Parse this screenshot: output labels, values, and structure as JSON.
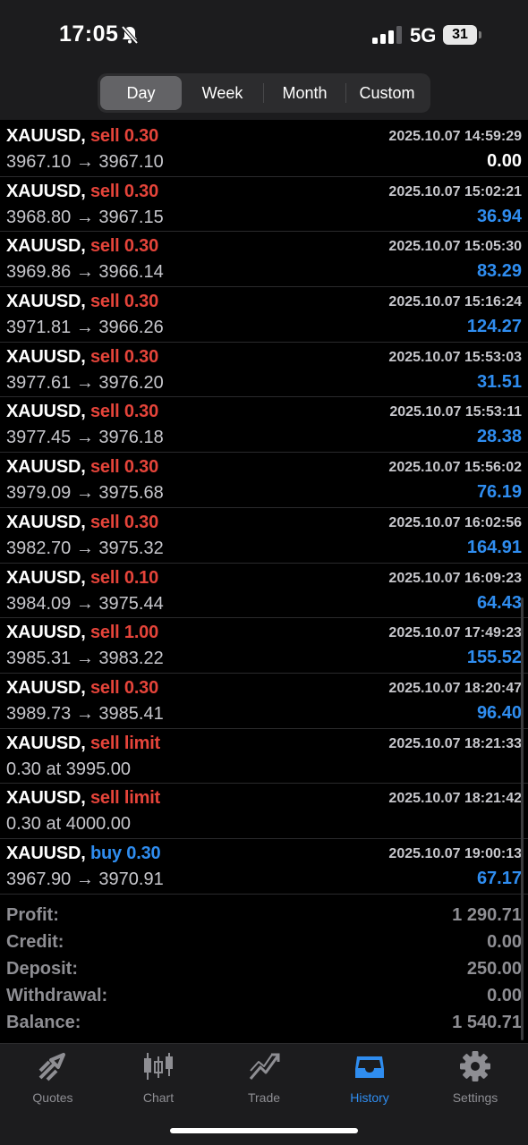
{
  "status": {
    "time": "17:05",
    "network": "5G",
    "battery": "31"
  },
  "segments": [
    {
      "label": "Day",
      "active": true
    },
    {
      "label": "Week",
      "active": false
    },
    {
      "label": "Month",
      "active": false
    },
    {
      "label": "Custom",
      "active": false
    }
  ],
  "trades": [
    {
      "symbol": "XAUUSD,",
      "side": "sell 0.30",
      "dir": "sell",
      "time": "2025.10.07 14:59:29",
      "detail": "3967.10 → 3967.10",
      "profit": "0.00",
      "zero": true
    },
    {
      "symbol": "XAUUSD,",
      "side": "sell 0.30",
      "dir": "sell",
      "time": "2025.10.07 15:02:21",
      "detail": "3968.80 → 3967.15",
      "profit": "36.94"
    },
    {
      "symbol": "XAUUSD,",
      "side": "sell 0.30",
      "dir": "sell",
      "time": "2025.10.07 15:05:30",
      "detail": "3969.86 → 3966.14",
      "profit": "83.29"
    },
    {
      "symbol": "XAUUSD,",
      "side": "sell 0.30",
      "dir": "sell",
      "time": "2025.10.07 15:16:24",
      "detail": "3971.81 → 3966.26",
      "profit": "124.27"
    },
    {
      "symbol": "XAUUSD,",
      "side": "sell 0.30",
      "dir": "sell",
      "time": "2025.10.07 15:53:03",
      "detail": "3977.61 → 3976.20",
      "profit": "31.51"
    },
    {
      "symbol": "XAUUSD,",
      "side": "sell 0.30",
      "dir": "sell",
      "time": "2025.10.07 15:53:11",
      "detail": "3977.45 → 3976.18",
      "profit": "28.38"
    },
    {
      "symbol": "XAUUSD,",
      "side": "sell 0.30",
      "dir": "sell",
      "time": "2025.10.07 15:56:02",
      "detail": "3979.09 → 3975.68",
      "profit": "76.19"
    },
    {
      "symbol": "XAUUSD,",
      "side": "sell 0.30",
      "dir": "sell",
      "time": "2025.10.07 16:02:56",
      "detail": "3982.70 → 3975.32",
      "profit": "164.91"
    },
    {
      "symbol": "XAUUSD,",
      "side": "sell 0.10",
      "dir": "sell",
      "time": "2025.10.07 16:09:23",
      "detail": "3984.09 → 3975.44",
      "profit": "64.43"
    },
    {
      "symbol": "XAUUSD,",
      "side": "sell 1.00",
      "dir": "sell",
      "time": "2025.10.07 17:49:23",
      "detail": "3985.31 → 3983.22",
      "profit": "155.52"
    },
    {
      "symbol": "XAUUSD,",
      "side": "sell 0.30",
      "dir": "sell",
      "time": "2025.10.07 18:20:47",
      "detail": "3989.73 → 3985.41",
      "profit": "96.40"
    },
    {
      "symbol": "XAUUSD,",
      "side": "sell limit",
      "dir": "sell",
      "time": "2025.10.07 18:21:33",
      "detail": "0.30 at 3995.00",
      "profit": ""
    },
    {
      "symbol": "XAUUSD,",
      "side": "sell limit",
      "dir": "sell",
      "time": "2025.10.07 18:21:42",
      "detail": "0.30 at 4000.00",
      "profit": ""
    },
    {
      "symbol": "XAUUSD,",
      "side": "buy 0.30",
      "dir": "buy",
      "time": "2025.10.07 19:00:13",
      "detail": "3967.90 → 3970.91",
      "profit": "67.17"
    }
  ],
  "summary": [
    {
      "label": "Profit:",
      "value": "1 290.71"
    },
    {
      "label": "Credit:",
      "value": "0.00"
    },
    {
      "label": "Deposit:",
      "value": "250.00"
    },
    {
      "label": "Withdrawal:",
      "value": "0.00"
    },
    {
      "label": "Balance:",
      "value": "1 540.71"
    }
  ],
  "tabs": [
    {
      "label": "Quotes",
      "icon": "quotes-icon"
    },
    {
      "label": "Chart",
      "icon": "chart-icon"
    },
    {
      "label": "Trade",
      "icon": "trade-icon"
    },
    {
      "label": "History",
      "icon": "history-icon",
      "active": true
    },
    {
      "label": "Settings",
      "icon": "settings-icon"
    }
  ],
  "colors": {
    "sell": "#e5443a",
    "buy": "#2f8df0",
    "profit": "#2f8df0",
    "active_tab": "#2f8df0"
  }
}
